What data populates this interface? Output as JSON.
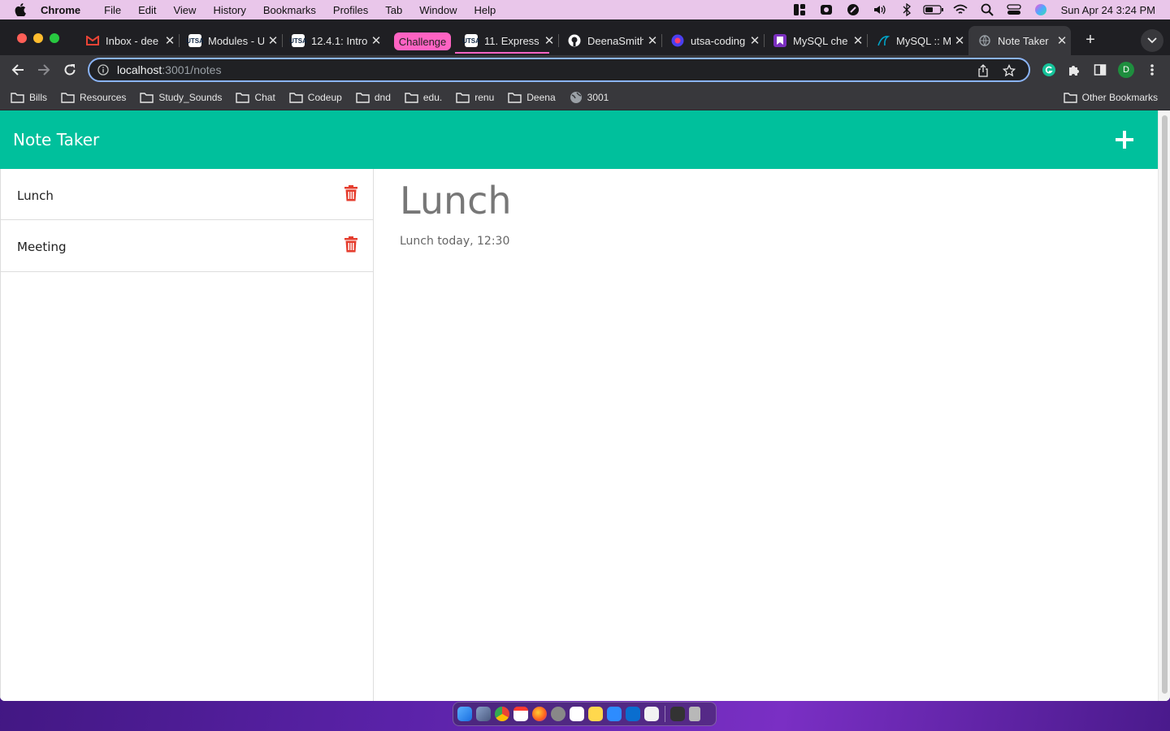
{
  "menubar": {
    "app_name": "Chrome",
    "menus": [
      "File",
      "Edit",
      "View",
      "History",
      "Bookmarks",
      "Profiles",
      "Tab",
      "Window",
      "Help"
    ],
    "clock": "Sun Apr 24  3:24 PM"
  },
  "tabs": [
    {
      "title": "Inbox - dee",
      "favicon": "gmail-icon",
      "color": "#ea4335"
    },
    {
      "title": "Modules - U",
      "favicon": "utsa-icon",
      "color": "#ffffff"
    },
    {
      "title": "12.4.1: Intro",
      "favicon": "utsa-icon",
      "color": "#ffffff"
    },
    {
      "title": "11. Express",
      "favicon": "utsa-icon",
      "color": "#ffffff"
    },
    {
      "title": "DeenaSmith",
      "favicon": "github-icon",
      "color": "#ffffff"
    },
    {
      "title": "utsa-coding",
      "favicon": "utsa-coding-icon",
      "color": "#4b3ff0"
    },
    {
      "title": "MySQL che",
      "favicon": "mysql-cheat-icon",
      "color": "#7b2fbf"
    },
    {
      "title": "MySQL :: M",
      "favicon": "mysql-icon",
      "color": "#00758f"
    },
    {
      "title": "Note Taker",
      "favicon": "globe-icon",
      "color": "#9aa0a6",
      "active": true
    }
  ],
  "tab_group": {
    "label": "Challenge",
    "color": "#ff63c3"
  },
  "address_bar": {
    "host": "localhost",
    "path": ":3001/notes"
  },
  "bookmarks": [
    "Bills",
    "Resources",
    "Study_Sounds",
    "Chat",
    "Codeup",
    "dnd",
    "edu.",
    "renu",
    "Deena",
    "3001"
  ],
  "other_bookmarks": "Other Bookmarks",
  "profile_initial": "D",
  "app": {
    "title": "Note Taker",
    "header_color": "#00c09c",
    "notes": [
      {
        "title": "Lunch"
      },
      {
        "title": "Meeting"
      }
    ],
    "active_note": {
      "title": "Lunch",
      "text": "Lunch today, 12:30"
    }
  }
}
